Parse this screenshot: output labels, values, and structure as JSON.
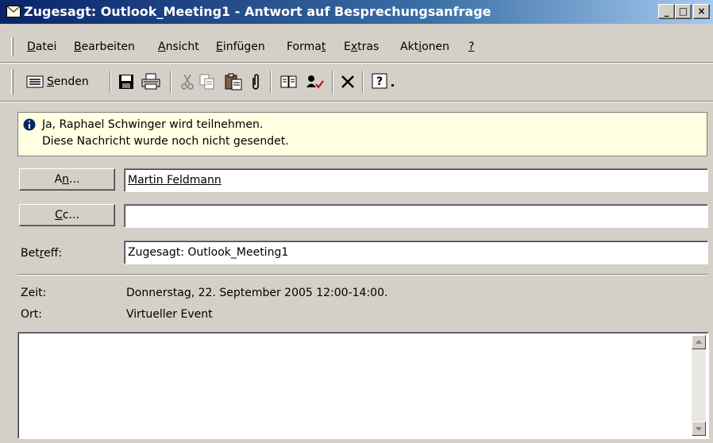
{
  "window": {
    "title": "Zugesagt: Outlook_Meeting1 - Antwort auf Besprechungsanfrage",
    "controls": {
      "minimize": "_",
      "maximize": "□",
      "close": "×"
    }
  },
  "menu": [
    {
      "pre": "",
      "u": "D",
      "post": "atei"
    },
    {
      "pre": "",
      "u": "B",
      "post": "earbeiten"
    },
    {
      "pre": "",
      "u": "A",
      "post": "nsicht"
    },
    {
      "pre": "",
      "u": "E",
      "post": "infügen"
    },
    {
      "pre": "Forma",
      "u": "t",
      "post": ""
    },
    {
      "pre": "E",
      "u": "x",
      "post": "tras"
    },
    {
      "pre": "Akt",
      "u": "i",
      "post": "onen"
    },
    {
      "pre": "",
      "u": "?",
      "post": ""
    }
  ],
  "toolbar": {
    "send_pre": "",
    "send_u": "S",
    "send_post": "enden",
    "icons": [
      "save-icon",
      "print-icon",
      "cut-icon",
      "copy-icon",
      "paste-icon",
      "attach-icon",
      "address-book-icon",
      "check-names-icon",
      "delete-icon",
      "help-icon"
    ]
  },
  "info": {
    "line1": "Ja, Raphael Schwinger wird teilnehmen.",
    "line2": "Diese Nachricht wurde noch nicht gesendet."
  },
  "fields": {
    "to_btn_pre": "A",
    "to_btn_u": "n",
    "to_btn_post": "...",
    "to_value": "Martin Feldmann",
    "cc_btn_pre": "",
    "cc_btn_u": "C",
    "cc_btn_post": "c...",
    "cc_value": "",
    "subject_label_pre": "Bet",
    "subject_label_u": "r",
    "subject_label_post": "eff:",
    "subject_value": "Zugesagt: Outlook_Meeting1"
  },
  "meeting": {
    "time_label": "Zeit:",
    "time_value": "Donnerstag, 22. September 2005 12:00-14:00.",
    "location_label": "Ort:",
    "location_value": "Virtueller Event"
  },
  "colors": {
    "titlebar_start": "#0a246a",
    "titlebar_end": "#a6caf0",
    "face": "#d4d0c8",
    "infobar": "#ffffe1"
  }
}
